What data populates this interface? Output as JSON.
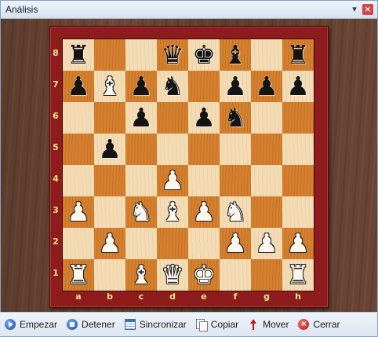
{
  "window": {
    "title": "Análisis",
    "menu_glyph": "▾",
    "close_glyph": "×"
  },
  "board": {
    "ranks": [
      "8",
      "7",
      "6",
      "5",
      "4",
      "3",
      "2",
      "1"
    ],
    "files": [
      "a",
      "b",
      "c",
      "d",
      "e",
      "f",
      "g",
      "h"
    ],
    "position": [
      [
        "br",
        "",
        "",
        "bq",
        "bk",
        "bb",
        "",
        "br"
      ],
      [
        "bp",
        "wb",
        "bp",
        "bn",
        "",
        "bp",
        "bp",
        "bp"
      ],
      [
        "",
        "",
        "bp",
        "",
        "bp",
        "bn",
        "",
        ""
      ],
      [
        "",
        "bp",
        "",
        "",
        "",
        "",
        "",
        ""
      ],
      [
        "",
        "",
        "",
        "wp",
        "",
        "",
        "",
        ""
      ],
      [
        "wp",
        "",
        "wn",
        "wb",
        "wp",
        "wn",
        "",
        ""
      ],
      [
        "",
        "wp",
        "",
        "",
        "",
        "wp",
        "wp",
        "wp"
      ],
      [
        "wr",
        "",
        "wb",
        "wq",
        "wk",
        "",
        "",
        "wr"
      ]
    ],
    "piece_glyphs": {
      "k": "♚",
      "q": "♛",
      "r": "♜",
      "b": "♝",
      "n": "♞",
      "p": "♟"
    }
  },
  "toolbar": {
    "start_label": "Empezar",
    "stop_label": "Detener",
    "sync_label": "Sincronizar",
    "copy_label": "Copiar",
    "move_label": "Mover",
    "close_label": "Cerrar"
  },
  "colors": {
    "light_square": "#f3dcb4",
    "dark_square": "#d4802e",
    "frame": "#8e1c1c",
    "coordinate_text": "#f3e38a"
  }
}
